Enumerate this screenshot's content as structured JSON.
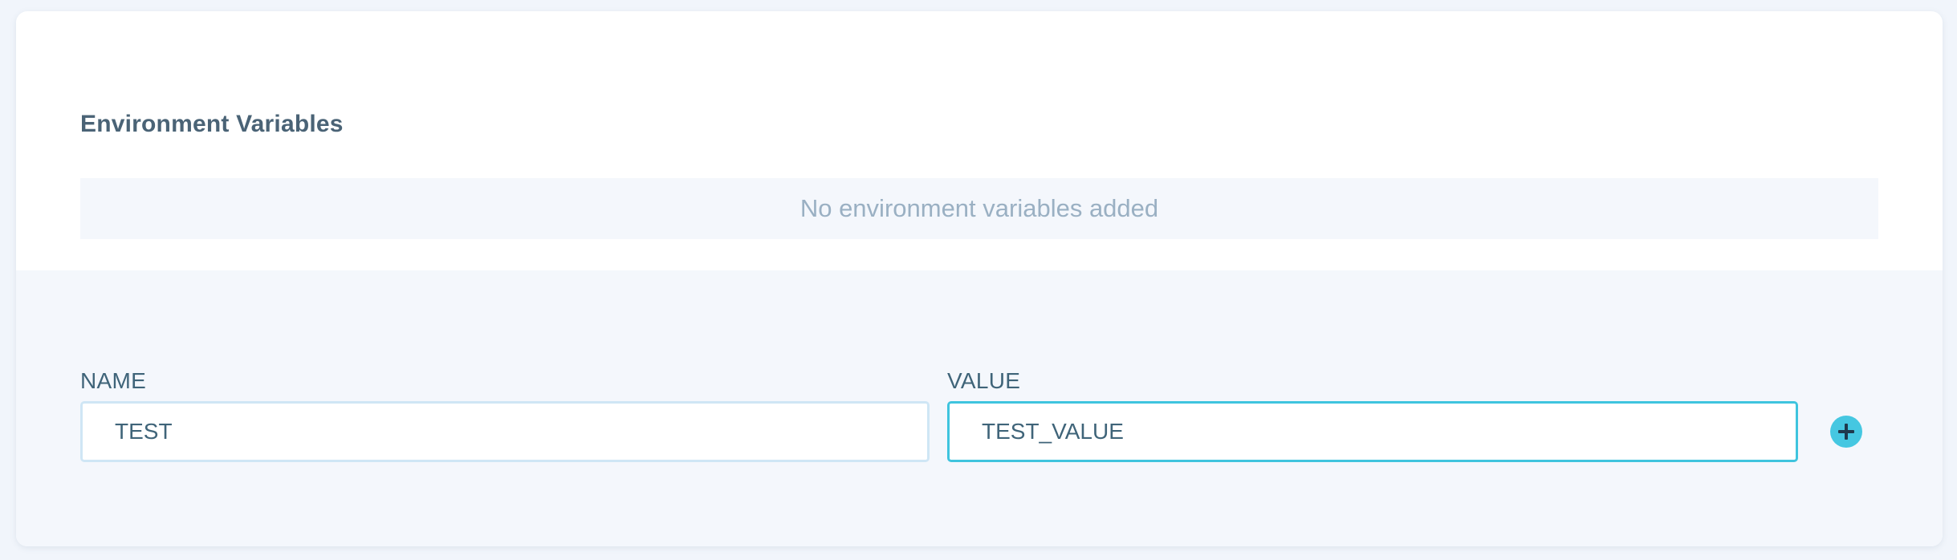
{
  "env_section": {
    "title": "Environment Variables",
    "empty_message": "No environment variables added"
  },
  "form": {
    "name_label": "NAME",
    "name_value": "TEST",
    "value_label": "VALUE",
    "value_value": "TEST_VALUE",
    "add_icon": "plus-icon"
  },
  "colors": {
    "accent": "#45c7e1",
    "focus_border": "#3fc4de",
    "title_text": "#4a6376",
    "muted_text": "#9ab0c3"
  }
}
